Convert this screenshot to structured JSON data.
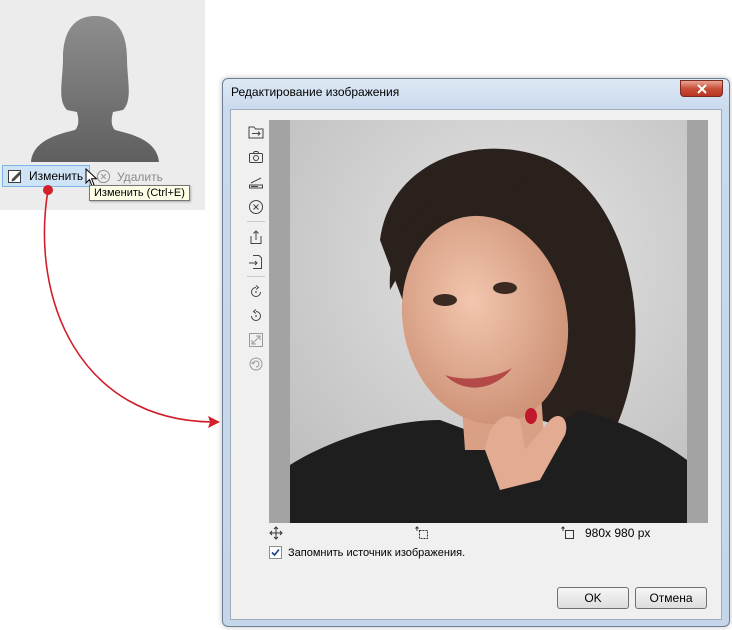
{
  "avatar_panel": {
    "edit_label": "Изменить",
    "delete_label": "Удалить",
    "tooltip": "Изменить (Ctrl+E)"
  },
  "dialog": {
    "title": "Редактирование изображения",
    "toolbar_icons": [
      "open-folder-icon",
      "camera-icon",
      "scanner-icon",
      "clear-icon",
      "export-icon",
      "import-icon",
      "rotate-clockwise-icon",
      "rotate-counterclockwise-icon",
      "fit-icon",
      "reset-icon"
    ],
    "image_size": "980x 980 px",
    "remember_source_label": "Запомнить источник изображения.",
    "remember_source_checked": true,
    "ok_label": "OK",
    "cancel_label": "Отмена"
  },
  "colors": {
    "connector": "#d11f2b",
    "accent": "#7eb4ea",
    "close_button": "#c9503a"
  }
}
